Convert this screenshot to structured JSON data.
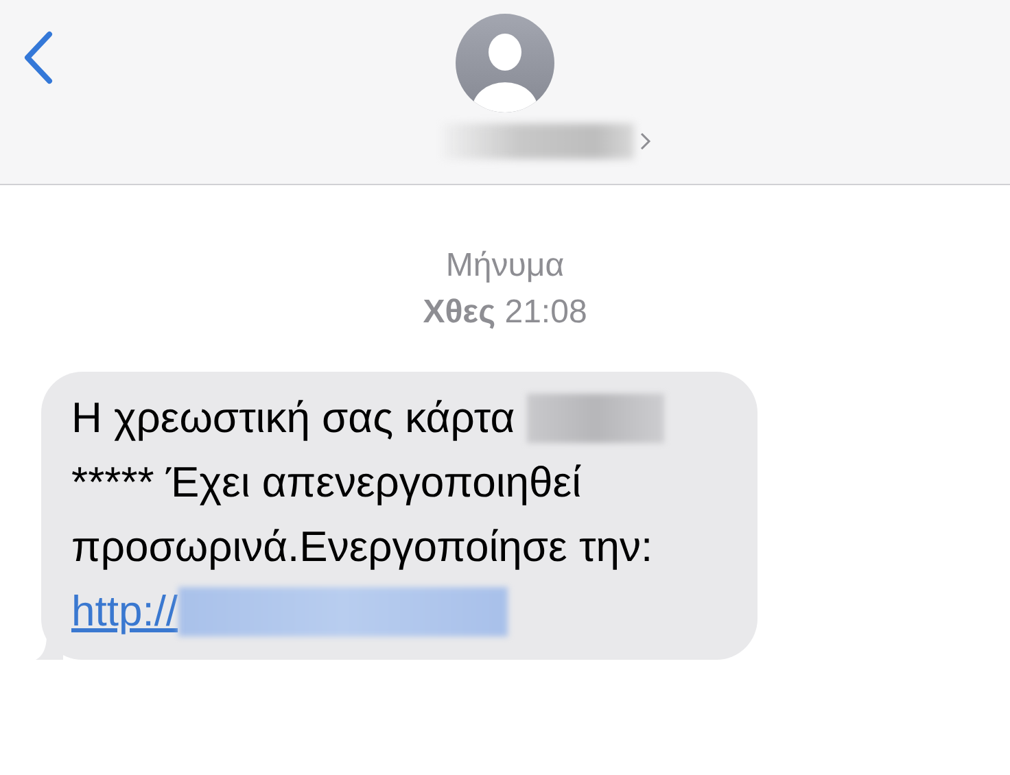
{
  "conversation": {
    "service": "Μήνυμα",
    "timestamp": "**Χθες** 21:08"
  },
  "messages": [
    {
      "parts": [
        {
          "kind": "text",
          "text": "Η χρεωστική σας κάρτα "
        },
        {
          "kind": "redacted"
        },
        {
          "kind": "text",
          "text": "***** Έχει απενεργοποιηθεί προσωρινά.Ενεργοποίησε την: "
        },
        {
          "kind": "link",
          "text": "http://"
        },
        {
          "kind": "redacted_link"
        }
      ]
    }
  ]
}
